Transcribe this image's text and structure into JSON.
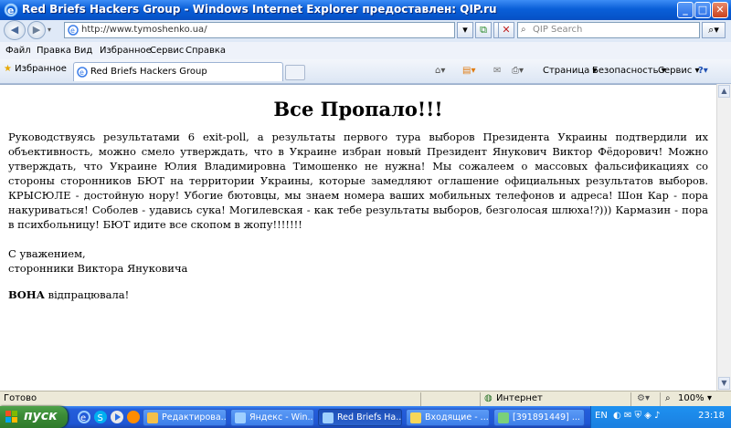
{
  "window": {
    "title": "Red Briefs Hackers Group - Windows Internet Explorer предоставлен: QIP.ru",
    "min_label": "_",
    "max_label": "□",
    "close_label": "✕"
  },
  "addressbar": {
    "url": "http://www.tymoshenko.ua/",
    "search_placeholder": "QIP Search"
  },
  "menu": [
    "Файл",
    "Правка",
    "Вид",
    "Избранное",
    "Сервис",
    "Справка"
  ],
  "favbar": {
    "favorites_label": "Избранное",
    "tab_label": "Red Briefs Hackers Group",
    "page_label": "Страница ▾",
    "security_label": "Безопасность ▾",
    "service_label": "Сервис ▾",
    "help_label": "?▾"
  },
  "page": {
    "heading": "Все Пропало!!!",
    "paragraph": "Руководствуясь результатами 6 exit-poll, а результаты первого тура выборов Президента Украины подтвердили их объективность, можно смело утверждать, что в Украине избран новый Президент Янукович Виктор Фёдорович! Можно утверждать, что Украине Юлия Владимировна Тимошенко не нужна! Мы сожалеем о массовых фальсификациях со стороны сторонников БЮТ на территории Украины, которые замедляют оглашение официальных результатов выборов. КРЫСЮЛЕ - достойную нору! Убогие бютовцы, мы знаем номера ваших мобильных телефонов и адреса! Шон Кар - пора накуриваться! Соболев - удавись сука! Могилевская - как тебе результаты выборов, безголосая шлюха!?))) Кармазин - пора в психбольницу! БЮТ идите все скопом в жопу!!!!!!!",
    "sign_line1": "С уважением,",
    "sign_line2": "сторонники Виктора Януковича",
    "vona_bold": "ВОНА",
    "vona_rest": " відпрацювала!"
  },
  "status": {
    "left": "Готово",
    "zone": "Интернет",
    "zoom": "100%",
    "zoom_arrow": "▾"
  },
  "taskbar": {
    "start_label": "пуск",
    "buttons": [
      "Редактирова...",
      "Яндекс - Win...",
      "Red Briefs Ha...",
      "Входящие - ...",
      "[391891449] ..."
    ],
    "language": "EN",
    "clock": "23:18"
  },
  "colors": {
    "titlebar": "#0a5fd8",
    "taskbar": "#245edb",
    "start": "#3c8c37"
  }
}
